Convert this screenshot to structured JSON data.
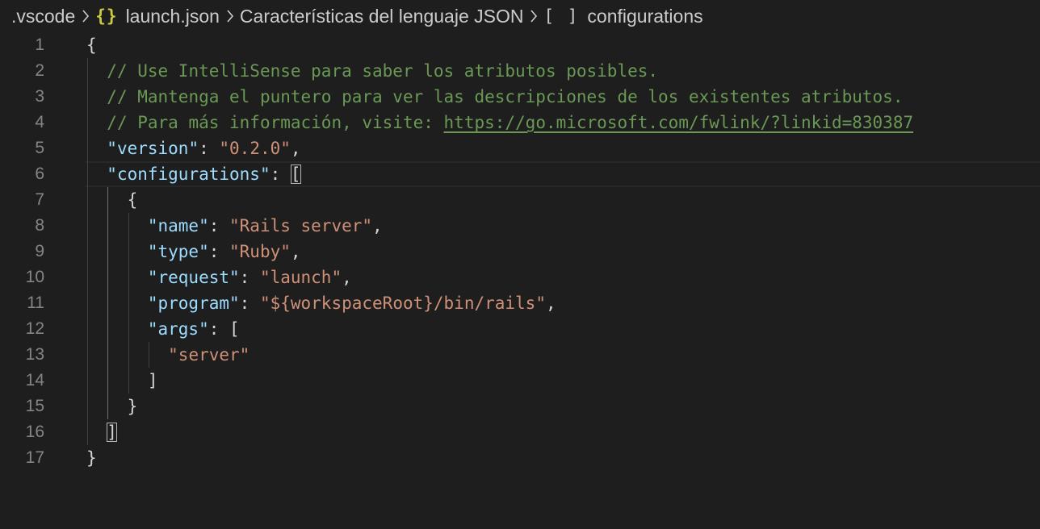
{
  "breadcrumb": {
    "items": [
      {
        "label": ".vscode",
        "icon": ""
      },
      {
        "label": "launch.json",
        "icon": "json-braces-icon",
        "glyph": "{}"
      },
      {
        "label": "Características del lenguaje JSON",
        "icon": ""
      },
      {
        "label": "configurations",
        "icon": "array-brackets-icon",
        "glyph": "[ ]"
      }
    ]
  },
  "editor": {
    "line_numbers": [
      "1",
      "2",
      "3",
      "4",
      "5",
      "6",
      "7",
      "8",
      "9",
      "10",
      "11",
      "12",
      "13",
      "14",
      "15",
      "16",
      "17"
    ],
    "lines": [
      {
        "indent": "",
        "tokens": [
          {
            "t": "punc",
            "v": "{"
          }
        ]
      },
      {
        "indent": "  ",
        "tokens": [
          {
            "t": "com",
            "v": "// Use IntelliSense para saber los atributos posibles."
          }
        ]
      },
      {
        "indent": "  ",
        "tokens": [
          {
            "t": "com",
            "v": "// Mantenga el puntero para ver las descripciones de los existentes atributos."
          }
        ]
      },
      {
        "indent": "  ",
        "tokens": [
          {
            "t": "com",
            "v": "// Para más información, visite: "
          },
          {
            "t": "link",
            "v": "https://go.microsoft.com/fwlink/?linkid=830387"
          }
        ]
      },
      {
        "indent": "  ",
        "tokens": [
          {
            "t": "key",
            "v": "\"version\""
          },
          {
            "t": "punc",
            "v": ": "
          },
          {
            "t": "str",
            "v": "\"0.2.0\""
          },
          {
            "t": "punc",
            "v": ","
          }
        ]
      },
      {
        "indent": "  ",
        "tokens": [
          {
            "t": "key",
            "v": "\"configurations\""
          },
          {
            "t": "punc",
            "v": ": "
          },
          {
            "t": "match",
            "v": "["
          }
        ]
      },
      {
        "indent": "    ",
        "tokens": [
          {
            "t": "punc",
            "v": "{"
          }
        ]
      },
      {
        "indent": "      ",
        "tokens": [
          {
            "t": "key",
            "v": "\"name\""
          },
          {
            "t": "punc",
            "v": ": "
          },
          {
            "t": "str",
            "v": "\"Rails server\""
          },
          {
            "t": "punc",
            "v": ","
          }
        ]
      },
      {
        "indent": "      ",
        "tokens": [
          {
            "t": "key",
            "v": "\"type\""
          },
          {
            "t": "punc",
            "v": ": "
          },
          {
            "t": "str",
            "v": "\"Ruby\""
          },
          {
            "t": "punc",
            "v": ","
          }
        ]
      },
      {
        "indent": "      ",
        "tokens": [
          {
            "t": "key",
            "v": "\"request\""
          },
          {
            "t": "punc",
            "v": ": "
          },
          {
            "t": "str",
            "v": "\"launch\""
          },
          {
            "t": "punc",
            "v": ","
          }
        ]
      },
      {
        "indent": "      ",
        "tokens": [
          {
            "t": "key",
            "v": "\"program\""
          },
          {
            "t": "punc",
            "v": ": "
          },
          {
            "t": "str",
            "v": "\"${workspaceRoot}/bin/rails\""
          },
          {
            "t": "punc",
            "v": ","
          }
        ]
      },
      {
        "indent": "      ",
        "tokens": [
          {
            "t": "key",
            "v": "\"args\""
          },
          {
            "t": "punc",
            "v": ": ["
          }
        ]
      },
      {
        "indent": "        ",
        "tokens": [
          {
            "t": "str",
            "v": "\"server\""
          }
        ]
      },
      {
        "indent": "      ",
        "tokens": [
          {
            "t": "punc",
            "v": "]"
          }
        ]
      },
      {
        "indent": "    ",
        "tokens": [
          {
            "t": "punc",
            "v": "}"
          }
        ]
      },
      {
        "indent": "  ",
        "tokens": [
          {
            "t": "match",
            "v": "]"
          }
        ]
      },
      {
        "indent": "",
        "tokens": [
          {
            "t": "punc",
            "v": "}"
          }
        ]
      }
    ],
    "current_line": 6
  },
  "colors": {
    "background": "#1e1e1e",
    "key": "#9cdcfe",
    "string": "#ce9178",
    "comment": "#6a9955",
    "line_number": "#858585",
    "json_icon": "#cbcb41"
  }
}
